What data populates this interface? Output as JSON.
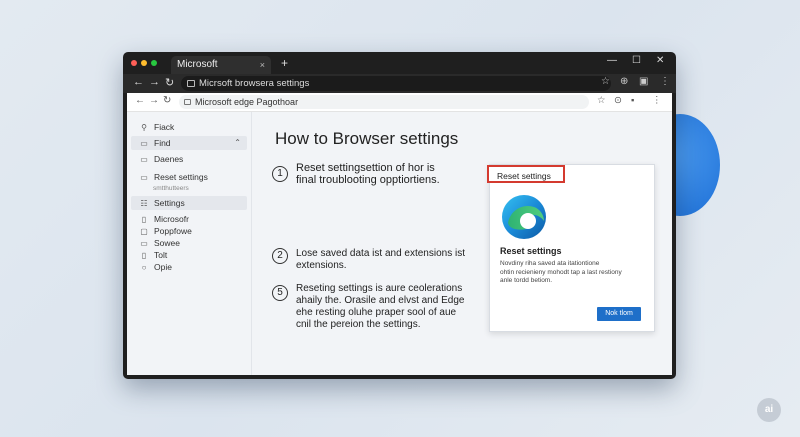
{
  "outer_browser": {
    "tab_title": "Microsoft",
    "tab_close": "×",
    "new_tab": "+",
    "url": "Micrsoft browsera settings",
    "window_controls": {
      "minimize": "—",
      "maximize": "☐",
      "close": "✕"
    },
    "traffic_light_colors": [
      "#ff5f57",
      "#ffbd2e",
      "#28c840"
    ]
  },
  "inner_browser": {
    "url": "Microsoft edge Pagothoar"
  },
  "sidebar": {
    "items": [
      {
        "label": "Fiack",
        "icon": "share-icon"
      },
      {
        "label": "Find",
        "icon": "find-icon",
        "chevron": "⌃"
      },
      {
        "label": "Daenes",
        "icon": "window-icon"
      },
      {
        "label": "Reset settings",
        "icon": "monitor-icon",
        "sub": "smtthutteers"
      },
      {
        "label": "Settings",
        "icon": "settings-icon",
        "selected": true
      },
      {
        "label": "Microsofr",
        "icon": "file-icon"
      },
      {
        "label": "Poppfowe",
        "icon": "box-icon"
      },
      {
        "label": "Sowee",
        "icon": "square-icon"
      },
      {
        "label": "Tolt",
        "icon": "shield-icon"
      },
      {
        "label": "Opie",
        "icon": "circle-icon"
      }
    ]
  },
  "main": {
    "title": "How to Browser settings",
    "steps": [
      {
        "num": "1",
        "line1": "Reset settingsettion of hor is",
        "line2": "final troublooting opptiortiens."
      },
      {
        "num": "2",
        "line1": "Lose saved data ist and extensions  ist",
        "line2": "extensions."
      },
      {
        "num": "5",
        "line1": "Reseting settings is aure ceolerations",
        "line2": "ahaily the. Orasile and elvst and Edge",
        "line3": "ehe resting oluhe praper sool of aue",
        "line4": "cnil the pereion the settings."
      }
    ]
  },
  "card": {
    "highlight_label": "Reset settings",
    "heading": "Reset settings",
    "desc1": "Novdiny riha saved ata itationtione",
    "desc2": "ohtin recienieny mohodt tap a last restiony",
    "desc3": "anle tordd betiom.",
    "button": "Nok tlom",
    "accent": "#1e6fc9",
    "highlight_color": "#d43a2f"
  },
  "watermark": "ai"
}
